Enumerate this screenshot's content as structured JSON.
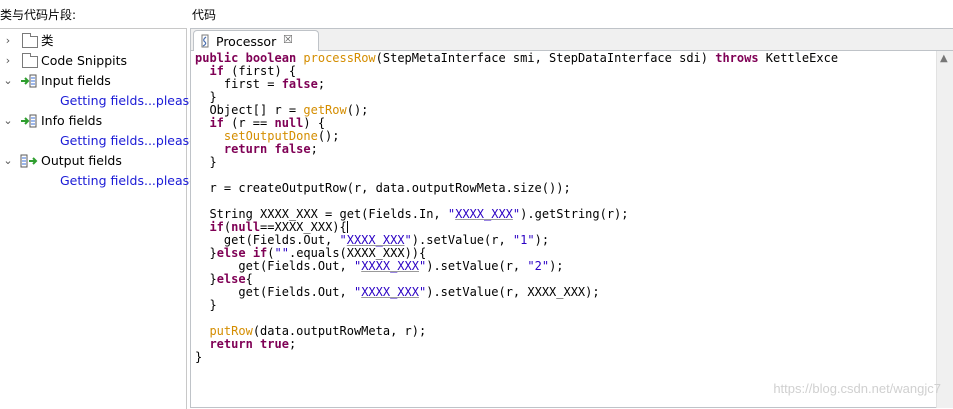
{
  "left_panel": {
    "title": "类与代码片段:",
    "items": [
      {
        "label": "类",
        "toggle": "›"
      },
      {
        "label": "Code Snippits",
        "toggle": "›"
      },
      {
        "label": "Input fields",
        "toggle": "⌄",
        "child": "Getting fields...please"
      },
      {
        "label": "Info fields",
        "toggle": "⌄",
        "child": "Getting fields...please"
      },
      {
        "label": "Output fields",
        "toggle": "⌄",
        "child": "Getting fields...please"
      }
    ]
  },
  "editor": {
    "title": "代码",
    "tab_label": "Processor",
    "tab_close": "☒",
    "code_lines": [
      "public boolean processRow(StepMetaInterface smi, StepDataInterface sdi) throws KettleExce",
      "  if (first) {",
      "    first = false;",
      "  }",
      "  Object[] r = getRow();",
      "  if (r == null) {",
      "    setOutputDone();",
      "    return false;",
      "  }",
      "",
      "  r = createOutputRow(r, data.outputRowMeta.size());",
      "",
      "  String XXXX_XXX = get(Fields.In, \"XXXX_XXX\").getString(r);",
      "  if(null==XXXX_XXX){",
      "    get(Fields.Out, \"XXXX_XXX\").setValue(r, \"1\");",
      "  }else if(\"\".equals(XXXX_XXX)){",
      "      get(Fields.Out, \"XXXX_XXX\").setValue(r, \"2\");",
      "  }else{",
      "      get(Fields.Out, \"XXXX_XXX\").setValue(r, XXXX_XXX);",
      "  }",
      "",
      "  putRow(data.outputRowMeta, r);",
      "  return true;",
      "}"
    ],
    "watermark": "https://blog.csdn.net/wangjc7"
  },
  "colors": {
    "keyword": "#7f0055",
    "method": "#d48d00",
    "string": "#2a00c4",
    "link": "#1a1ad6"
  },
  "icons": {
    "tab": "java-file-icon",
    "folder": "folder-icon",
    "input": "input-fields-icon",
    "info": "info-fields-icon",
    "output": "output-fields-icon"
  }
}
